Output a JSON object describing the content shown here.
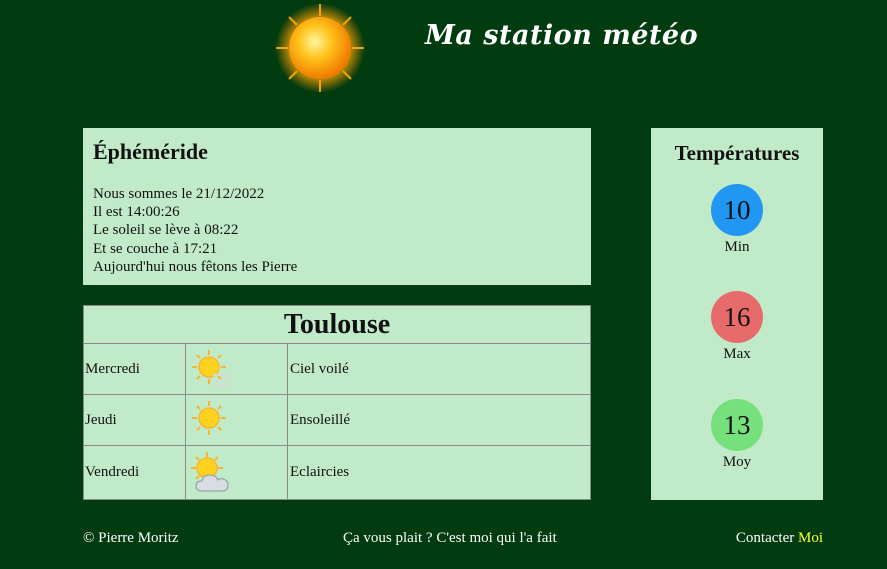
{
  "header": {
    "title": "Ma station météo",
    "logo_icon": "sun-icon"
  },
  "ephemeride": {
    "title": "Éphéméride",
    "lines": [
      "Nous sommes le 21/12/2022",
      "Il est 14:00:26",
      "Le soleil se lève à 08:22",
      "Et se couche à 17:21",
      "Aujourd'hui nous fêtons les Pierre"
    ]
  },
  "forecast": {
    "city": "Toulouse",
    "rows": [
      {
        "day": "Mercredi",
        "icon": "hazy-sun-icon",
        "description": "Ciel voilé"
      },
      {
        "day": "Jeudi",
        "icon": "sun-icon",
        "description": "Ensoleillé"
      },
      {
        "day": "Vendredi",
        "icon": "sun-cloud-icon",
        "description": "Eclaircies"
      }
    ]
  },
  "temperatures": {
    "title": "Températures",
    "min": {
      "value": "10",
      "label": "Min",
      "color": "#2196f3"
    },
    "max": {
      "value": "16",
      "label": "Max",
      "color": "#e86b6b"
    },
    "avg": {
      "value": "13",
      "label": "Moy",
      "color": "#76e07c"
    }
  },
  "footer": {
    "copyright": "© Pierre Moritz",
    "middle": "Ça vous plait ? C'est moi qui l'a fait",
    "contact_prefix": "Contacter",
    "contact_link": "Moi"
  },
  "colors": {
    "background": "#003c0f",
    "card": "#c1ebc8",
    "link": "#ffff33"
  }
}
